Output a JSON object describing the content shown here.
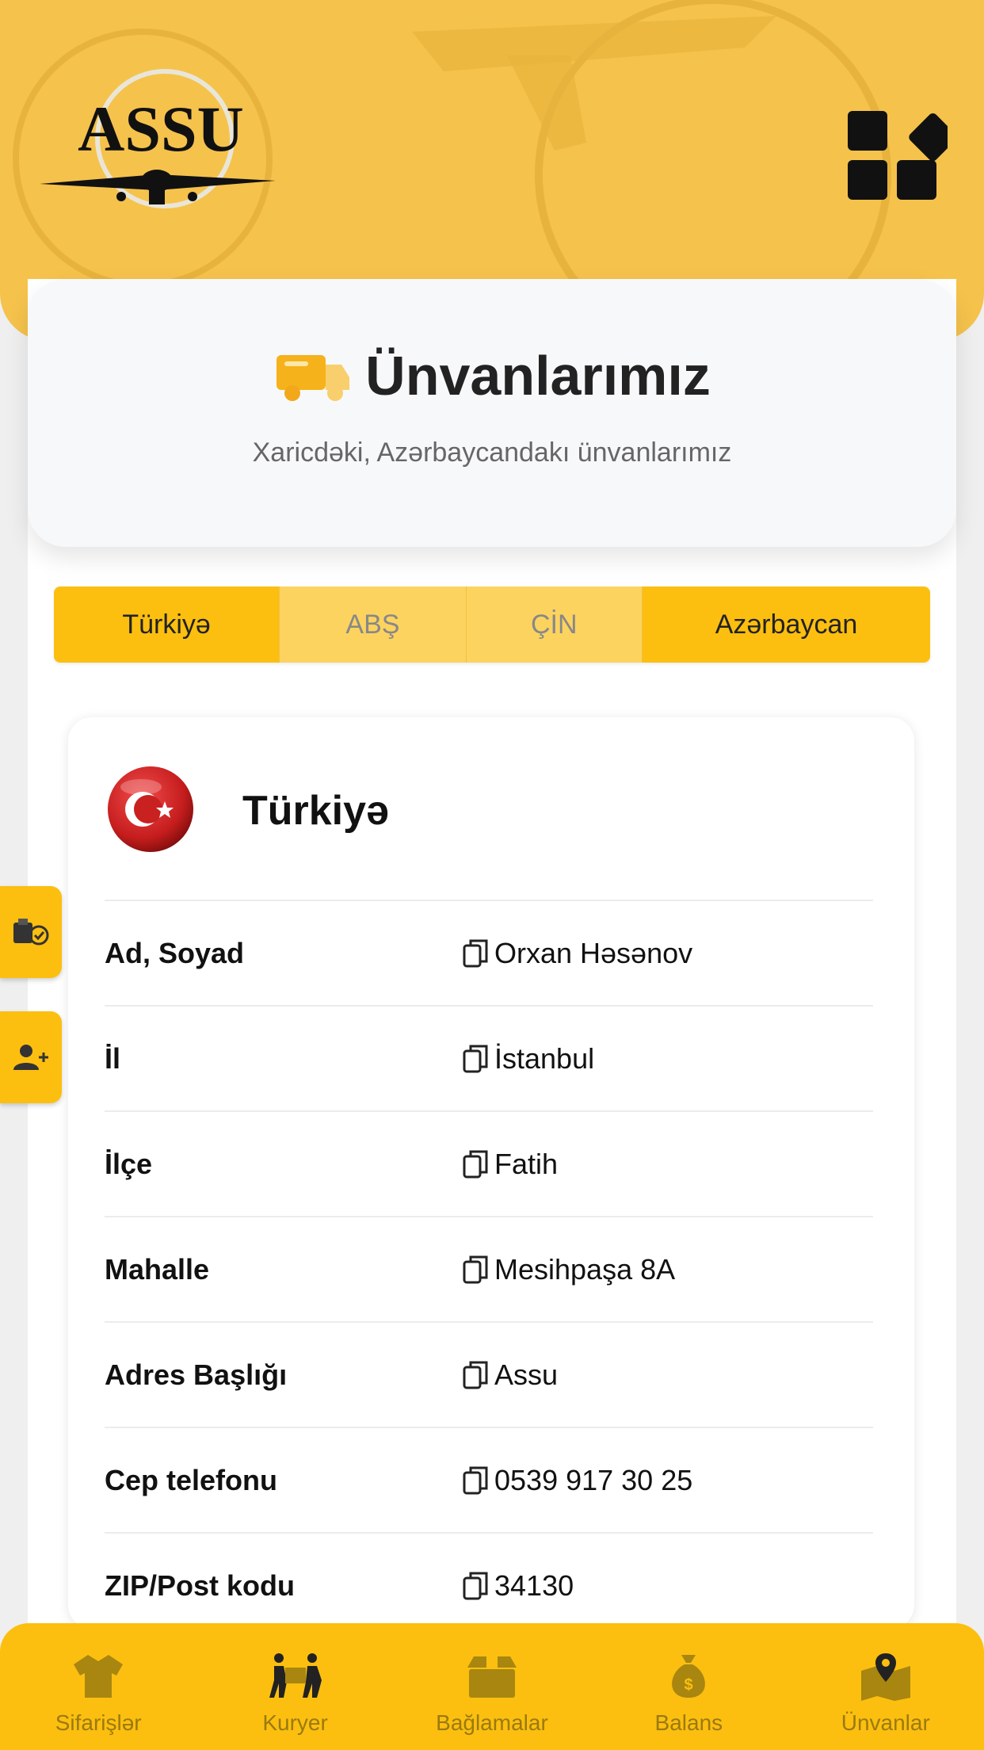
{
  "app": {
    "logo_text": "ASSU"
  },
  "header": {
    "title": "Ünvanlarımız",
    "subtitle": "Xaricdəki, Azərbaycandakı ünvanlarımız"
  },
  "tabs": [
    {
      "label": "Türkiyə",
      "active": true
    },
    {
      "label": "ABŞ",
      "active": false
    },
    {
      "label": "ÇİN",
      "active": false
    },
    {
      "label": "Azərbaycan",
      "active": true
    }
  ],
  "address_card": {
    "country": "Türkiyə",
    "flag_icon": "turkey-flag-icon",
    "rows": [
      {
        "label": "Ad, Soyad",
        "value": "Orxan Həsənov"
      },
      {
        "label": "İl",
        "value": "İstanbul"
      },
      {
        "label": "İlçe",
        "value": "Fatih"
      },
      {
        "label": "Mahalle",
        "value": "Mesihpaşa 8A"
      },
      {
        "label": "Adres Başlığı",
        "value": "Assu"
      },
      {
        "label": "Cep telefonu",
        "value": "0539 917 30 25"
      },
      {
        "label": "ZIP/Post kodu",
        "value": "34130"
      }
    ]
  },
  "side_buttons": [
    {
      "icon": "package-check-icon"
    },
    {
      "icon": "add-user-icon"
    }
  ],
  "bottom_nav": [
    {
      "label": "Sifarişlər",
      "icon": "tshirt-icon"
    },
    {
      "label": "Kuryer",
      "icon": "courier-icon"
    },
    {
      "label": "Bağlamalar",
      "icon": "box-icon"
    },
    {
      "label": "Balans",
      "icon": "money-bag-icon"
    },
    {
      "label": "Ünvanlar",
      "icon": "map-pin-icon"
    }
  ],
  "colors": {
    "accent": "#fcbf10",
    "header_bg": "#f5c24c",
    "tab_inactive": "#fdd35f",
    "nav_label": "#9a7a0e"
  }
}
